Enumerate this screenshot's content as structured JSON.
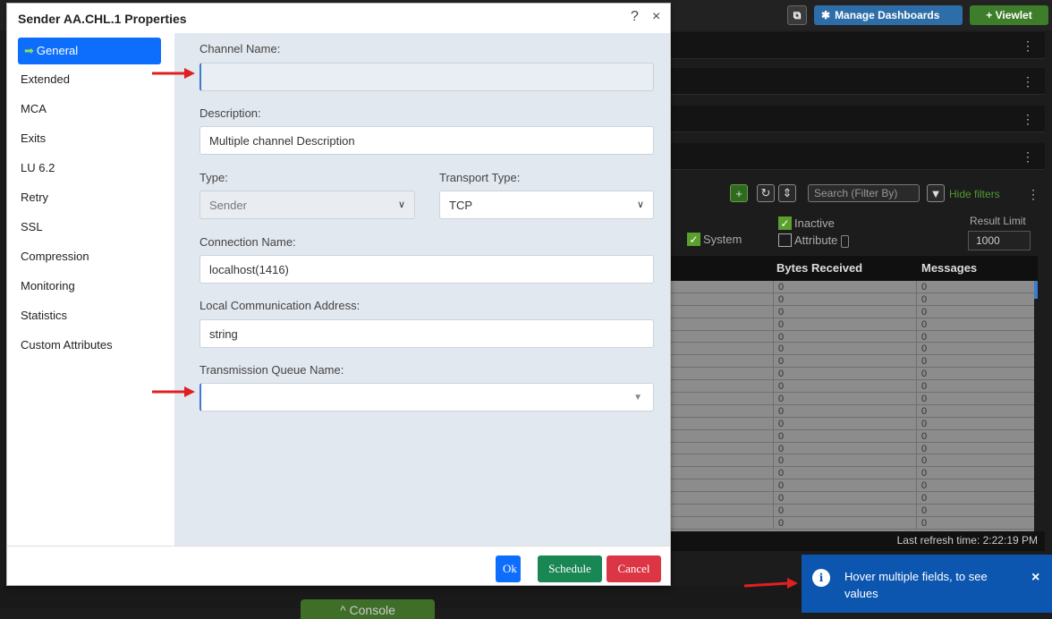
{
  "background": {
    "manage_dashboards": "Manage Dashboards",
    "viewlet": "+ Viewlet",
    "search_placeholder": "Search (Filter By)",
    "hide_filters": "Hide filters",
    "filter_system": "System",
    "filter_inactive": "Inactive",
    "filter_attribute": "Attribute",
    "result_limit_label": "Result Limit",
    "result_limit_value": "1000",
    "col_bytes_received": "Bytes Received",
    "col_messages": "Messages",
    "row_values": [
      "0",
      "0",
      "0",
      "0",
      "0",
      "0",
      "0",
      "0",
      "0",
      "0",
      "0",
      "0",
      "0",
      "0",
      "0",
      "0",
      "0",
      "0",
      "0",
      "0"
    ],
    "last_refresh": "Last refresh time: 2:22:19 PM",
    "console": "^ Console"
  },
  "dialog": {
    "title": "Sender AA.CHL.1 Properties",
    "help": "?",
    "close": "×",
    "nav": [
      "General",
      "Extended",
      "MCA",
      "Exits",
      "LU 6.2",
      "Retry",
      "SSL",
      "Compression",
      "Monitoring",
      "Statistics",
      "Custom Attributes"
    ],
    "fields": {
      "channel_name_label": "Channel Name:",
      "channel_name_value": "",
      "description_label": "Description:",
      "description_value": "Multiple channel Description",
      "type_label": "Type:",
      "type_value": "Sender",
      "transport_label": "Transport Type:",
      "transport_value": "TCP",
      "connection_label": "Connection Name:",
      "connection_value": "localhost(1416)",
      "local_addr_label": "Local Communication Address:",
      "local_addr_value": "string",
      "xmitq_label": "Transmission Queue Name:",
      "xmitq_value": ""
    },
    "buttons": {
      "ok": "Ok",
      "schedule": "Schedule",
      "cancel": "Cancel"
    }
  },
  "toast": {
    "message": "Hover multiple fields, to see values",
    "icon": "info-icon",
    "close": "×"
  },
  "colors": {
    "primary": "#0d6efd",
    "success": "#198754",
    "danger": "#dc3545",
    "toast": "#0d56b0",
    "annotation_arrow": "#e02020"
  }
}
